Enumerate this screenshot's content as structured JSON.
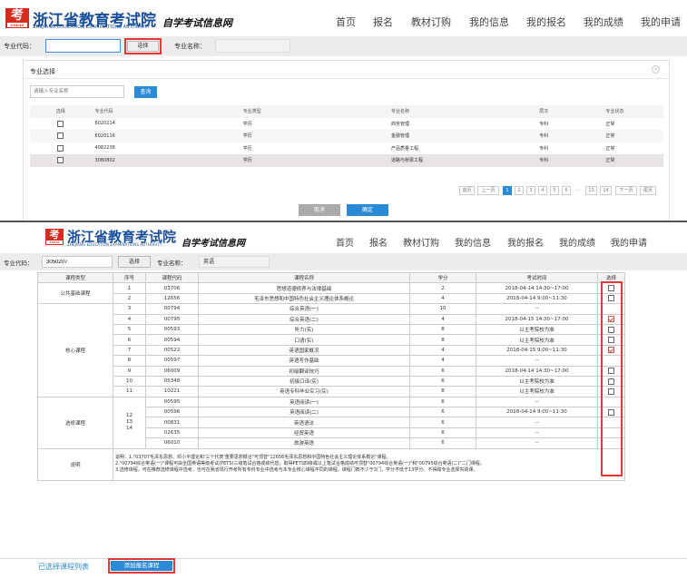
{
  "header1": {
    "logo_text": "考",
    "logo_badge": "ZSKAY",
    "title": "浙江省教育考试院",
    "title_en": "ZHEJIANG EDUCATION EXAMINATIONS AUTHORITY",
    "subtitle": "自学考试信息网"
  },
  "nav": [
    "首页",
    "报名",
    "教材订购",
    "我的信息",
    "我的报名",
    "我的成绩",
    "我的申请"
  ],
  "search1": {
    "code_label": "专业代码：",
    "code_value": "",
    "select_button": "选择",
    "name_label": "专业名称：",
    "name_value": ""
  },
  "modal": {
    "title": "专业选择",
    "close_icon": "close-icon",
    "search_placeholder": "请输入专业名称",
    "query_button": "查询",
    "columns": [
      "选择",
      "专业代码",
      "专业类型",
      "专业名称",
      "层次",
      "专业状态"
    ],
    "rows": [
      {
        "code": "6020214",
        "type": "学历",
        "name": "商务管理",
        "level": "专科",
        "status": "正常",
        "checked": false
      },
      {
        "code": "6020116",
        "type": "学历",
        "name": "金融管理",
        "level": "专科",
        "status": "正常",
        "checked": false
      },
      {
        "code": "4082238",
        "type": "学历",
        "name": "产品质量工程",
        "level": "专科",
        "status": "正常",
        "checked": false
      },
      {
        "code": "3080802",
        "type": "学历",
        "name": "道路与桥梁工程",
        "level": "专科",
        "status": "正常",
        "checked": false
      }
    ],
    "pagination": {
      "first": "首页",
      "prev": "上一页",
      "pages": [
        "1",
        "2",
        "3",
        "4",
        "5",
        "6",
        "...",
        "13",
        "14"
      ],
      "current": "1",
      "next": "下一页",
      "last": "尾页"
    },
    "cancel_button": "取消",
    "confirm_button": "确定"
  },
  "search2": {
    "code_label": "专业代码：",
    "code_value": "3050207",
    "select_button": "选择",
    "name_label": "专业名称：",
    "name_value": "英语"
  },
  "course_table": {
    "columns": [
      "课程类型",
      "序号",
      "课程代码",
      "课程名称",
      "学分",
      "考试时间",
      "选择"
    ],
    "groups": [
      {
        "type": "公共基础课程",
        "rows": [
          {
            "no": "1",
            "code": "03706",
            "name": "思想道德修养与法律基础",
            "credit": "2",
            "time": "2018-04-14 14:30~17:00",
            "checkbox": true,
            "checked": false
          },
          {
            "no": "2",
            "code": "12656",
            "name": "毛泽东思想和中国特色社会主义理论体系概论",
            "credit": "4",
            "time": "2018-04-14 9:00~11:30",
            "checkbox": true,
            "checked": false
          }
        ]
      },
      {
        "type": "核心课程",
        "rows": [
          {
            "no": "3",
            "code": "00794",
            "name": "综合英语(一)",
            "credit": "10",
            "time": "--",
            "checkbox": false,
            "checked": false
          },
          {
            "no": "4",
            "code": "00795",
            "name": "综合英语(二)",
            "credit": "4",
            "time": "2018-04-15 14:30~17:00",
            "checkbox": true,
            "checked": true
          },
          {
            "no": "5",
            "code": "00593",
            "name": "听力(实)",
            "credit": "8",
            "time": "以主考院校为准",
            "checkbox": true,
            "checked": false
          },
          {
            "no": "6",
            "code": "00594",
            "name": "口语(实)",
            "credit": "8",
            "time": "以主考院校为准",
            "checkbox": true,
            "checked": false
          },
          {
            "no": "7",
            "code": "00522",
            "name": "英语国家概况",
            "credit": "4",
            "time": "2018-04-15 9:00~11:30",
            "checkbox": true,
            "checked": true
          },
          {
            "no": "8",
            "code": "00597",
            "name": "英语写作基础",
            "credit": "4",
            "time": "--",
            "checkbox": false,
            "checked": false
          },
          {
            "no": "9",
            "code": "06009",
            "name": "初级翻译技巧",
            "credit": "6",
            "time": "2018-04-14 14:30~17:00",
            "checkbox": true,
            "checked": false
          },
          {
            "no": "10",
            "code": "05348",
            "name": "初级口译(实)",
            "credit": "6",
            "time": "以主考院校为准",
            "checkbox": true,
            "checked": false
          },
          {
            "no": "11",
            "code": "10221",
            "name": "英语专科毕业实习(实)",
            "credit": "8",
            "time": "以主考院校为准",
            "checkbox": true,
            "checked": false
          }
        ]
      },
      {
        "type": "选修课程",
        "no_text": "12\n13\n14",
        "rows": [
          {
            "code": "00595",
            "name": "英语阅读(一)",
            "credit": "6",
            "time": "--",
            "checkbox": false,
            "checked": false
          },
          {
            "code": "00596",
            "name": "英语阅读(二)",
            "credit": "6",
            "time": "2018-04-14 9:00~11:30",
            "checkbox": true,
            "checked": false
          },
          {
            "code": "00831",
            "name": "英语语法",
            "credit": "6",
            "time": "--",
            "checkbox": false,
            "checked": false
          },
          {
            "code": "02635",
            "name": "经贸英语",
            "credit": "6",
            "time": "--",
            "checkbox": false,
            "checked": false
          },
          {
            "code": "06010",
            "name": "旅游英语",
            "credit": "6",
            "time": "--",
            "checkbox": false,
            "checked": false
          }
        ]
      }
    ],
    "note_label": "说明",
    "note_lines": [
      "说明：1.\"03707毛泽东思想、邓小平理论和'三个代表'重要思想概论\"可顶替\"12656毛泽东思想和中国特色社会主义理论体系概论\"课程。",
      "2.\"00794综合英语(一)\"课程可由全国英语等级考试(PETS)三级笔试合格成绩代替，取得PETS四级或以上笔试合格成绩可顶替\"00794综合英语(一)\"和\"00795综合英语(二)\"二门课程。",
      "3.选修课程，可在推荐选修课程中选考，也可在我省现行开考所有专科专业中选考与本专业核心课程不同的课程，课程门数不少于3门，学分不低于13学分。不得跨专业选择实践课。"
    ]
  },
  "footer": {
    "selected_list_link": "已选择课程列表",
    "add_button": "添加报名课程"
  }
}
